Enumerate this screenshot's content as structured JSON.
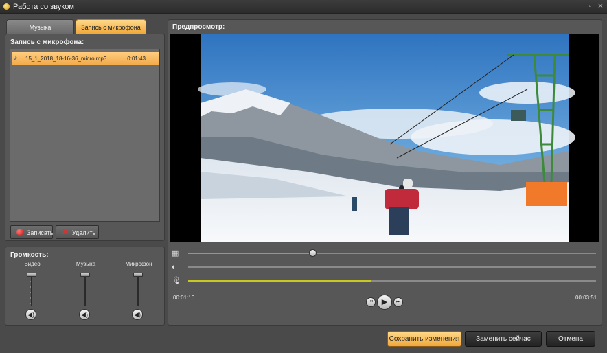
{
  "window": {
    "title": "Работа со звуком"
  },
  "tabs": [
    {
      "label": "Музыка",
      "active": false
    },
    {
      "label": "Запись с микрофона",
      "active": true
    }
  ],
  "recording": {
    "section_title": "Запись с микрофона:",
    "files": [
      {
        "name": "15_1_2018_18-16-36_micro.mp3",
        "duration": "0:01:43",
        "selected": true
      }
    ],
    "record_label": "Записать",
    "delete_label": "Удалить"
  },
  "volume": {
    "section_title": "Громкость:",
    "channels": [
      {
        "label": "Видео",
        "level": 1.0
      },
      {
        "label": "Музыка",
        "level": 1.0
      },
      {
        "label": "Микрофон",
        "level": 1.0
      }
    ]
  },
  "preview": {
    "title": "Предпросмотр:",
    "current_time": "00:01:10",
    "total_time": "00:03:51",
    "video_progress": 0.3,
    "music_progress": 0.0,
    "mic_progress": 0.45
  },
  "actions": {
    "save_label": "Сохранить изменения",
    "replace_label": "Заменить сейчас",
    "cancel_label": "Отмена"
  },
  "colors": {
    "accent": "#f0a83a",
    "video_track": "#f07a2a",
    "mic_track": "#c8c820",
    "record_dot": "#e02020",
    "delete_x": "#e03030"
  }
}
